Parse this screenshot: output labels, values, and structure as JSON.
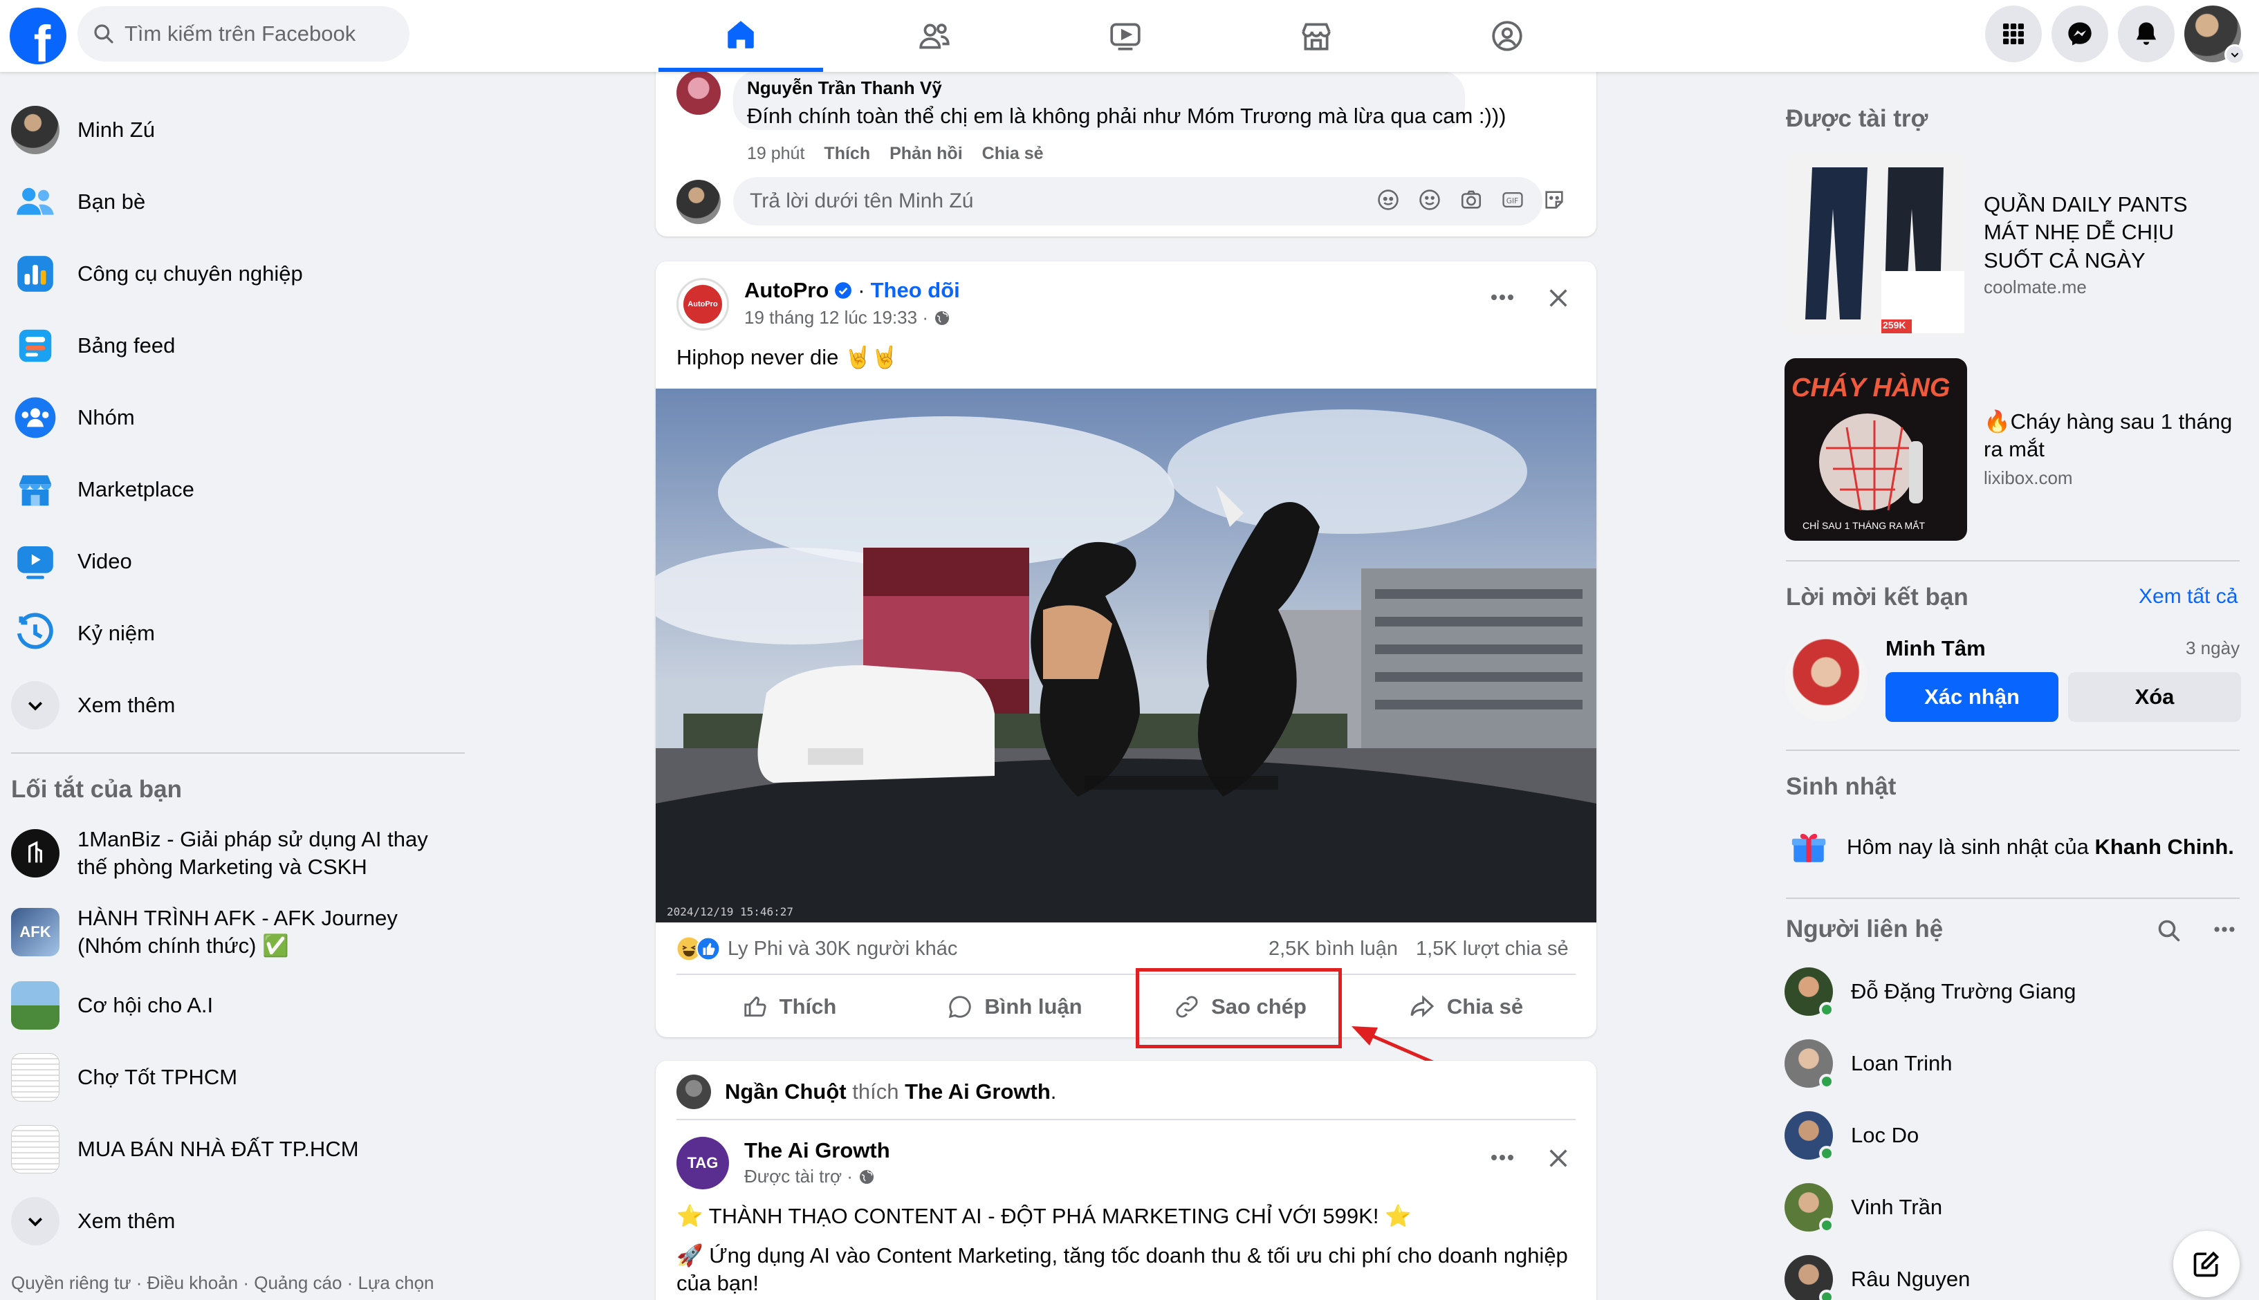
{
  "search": {
    "placeholder": "Tìm kiếm trên Facebook"
  },
  "sidebar": {
    "items": [
      {
        "label": "Minh Zú"
      },
      {
        "label": "Bạn bè"
      },
      {
        "label": "Công cụ chuyên nghiệp"
      },
      {
        "label": "Bảng feed"
      },
      {
        "label": "Nhóm"
      },
      {
        "label": "Marketplace"
      },
      {
        "label": "Video"
      },
      {
        "label": "Kỷ niệm"
      },
      {
        "label": "Xem thêm"
      }
    ],
    "shortcuts_title": "Lối tắt của bạn",
    "shortcuts": [
      {
        "label": "1ManBiz - Giải pháp sử dụng AI thay thế phòng Marketing và CSKH"
      },
      {
        "label": "HÀNH TRÌNH AFK - AFK Journey (Nhóm chính thức) ✅"
      },
      {
        "label": "Cơ hội cho A.I"
      },
      {
        "label": "Chợ Tốt TPHCM"
      },
      {
        "label": "MUA BÁN NHÀ ĐẤT TP.HCM"
      },
      {
        "label": "Xem thêm"
      }
    ],
    "footer": "Quyền riêng tư · Điều khoản · Quảng cáo · Lựa chọn"
  },
  "comment": {
    "author": "Nguyễn Trần Thanh Vỹ",
    "text": "Đính chính toàn thể chị em là không phải như Móm Trương mà lừa qua cam :)))",
    "time": "19 phút",
    "like": "Thích",
    "reply": "Phản hồi",
    "share": "Chia sẻ",
    "reply_placeholder": "Trả lời dưới tên Minh Zú"
  },
  "post": {
    "author": "AutoPro",
    "follow": "Theo dõi",
    "time": "19 tháng 12 lúc 19:33 ·",
    "text": "Hiphop never die 🤘🤘",
    "reactions": "Ly Phi và 30K người khác",
    "comments": "2,5K bình luận",
    "shares": "1,5K lượt chia sẻ",
    "actions": {
      "like": "Thích",
      "comment": "Bình luận",
      "copy": "Sao chép",
      "share": "Chia sẻ"
    }
  },
  "post2": {
    "activity_user": "Ngần Chuột",
    "activity_verb": "thích",
    "activity_page": "The Ai Growth",
    "author": "The Ai Growth",
    "sponsored": "Được tài trợ ·",
    "line1": "⭐ THÀNH THẠO CONTENT AI - ĐỘT PHÁ MARKETING CHỈ VỚI 599K! ⭐",
    "line2": "🚀 Ứng dụng AI vào Content Marketing, tăng tốc doanh thu & tối ưu chi phí cho doanh nghiệp của bạn!"
  },
  "right": {
    "sponsored_title": "Được tài trợ",
    "ads": [
      {
        "title": "QUẦN DAILY PANTS MÁT NHẸ DỄ CHỊU SUỐT CẢ NGÀY",
        "domain": "coolmate.me"
      },
      {
        "title": "🔥Cháy hàng sau 1 tháng ra mắt",
        "domain": "lixibox.com"
      }
    ],
    "friend_requests_title": "Lời mời kết bạn",
    "see_all": "Xem tất cả",
    "request": {
      "name": "Minh Tâm",
      "time": "3 ngày",
      "confirm": "Xác nhận",
      "delete": "Xóa"
    },
    "birthday_title": "Sinh nhật",
    "birthday_text": "Hôm nay là sinh nhật của",
    "birthday_name": "Khanh Chinh.",
    "contacts_title": "Người liên hệ",
    "contacts": [
      "Đỗ Đặng Trường Giang",
      "Loan Trinh",
      "Loc Do",
      "Vinh Trần",
      "Râu Nguyen"
    ]
  },
  "ad_images": {
    "pants_badge": "259K",
    "cheers_text": "CHÁY HÀNG",
    "cheers_sub": "CHỈ SAU 1 THÁNG RA MẮT"
  },
  "colors": {
    "brand": "#0866ff",
    "highlight_box": "#e02020"
  }
}
